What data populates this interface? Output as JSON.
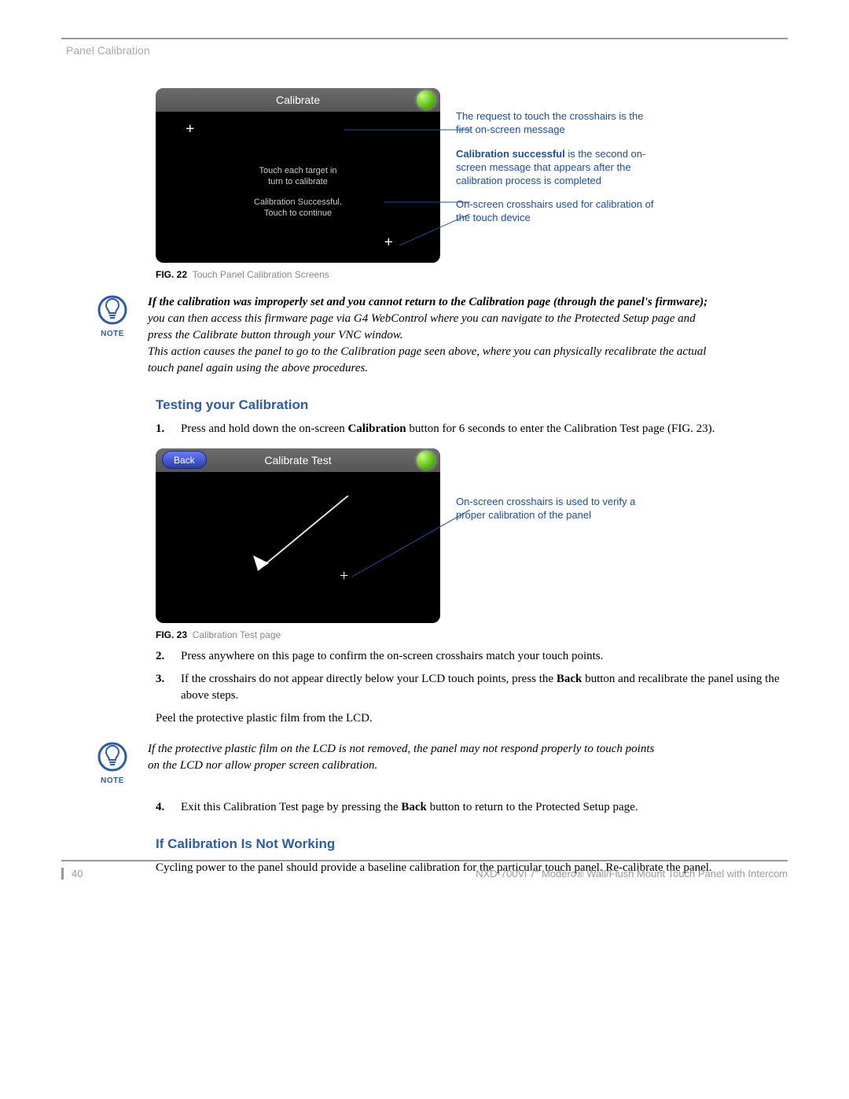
{
  "header": {
    "section_title": "Panel Calibration"
  },
  "fig22": {
    "screen_title": "Calibrate",
    "instruction1": "Touch each target in\nturn to calibrate",
    "instruction2": "Calibration Successful.\nTouch to continue",
    "caption_label": "FIG. 22",
    "caption_text": "Touch Panel Calibration Screens",
    "annot1": "The request to touch the crosshairs is the first on-screen message",
    "annot2_bold": "Calibration successful",
    "annot2_rest": " is the second on-screen message that appears after the calibration process is completed",
    "annot3": "On-screen crosshairs used for calibration of the touch device"
  },
  "note1": {
    "label": "NOTE",
    "bold_part": "If the calibration was improperly set and you cannot return to the Calibration page (through the panel's firmware);",
    "italic_part": " you can then access this firmware page via G4 WebControl where you can navigate to the Protected Setup page and press the Calibrate button through your VNC window.",
    "line2": "This action causes the panel to go to the Calibration page seen above, where you can physically recalibrate the actual touch panel again using the above procedures."
  },
  "heading1": "Testing your Calibration",
  "steps": {
    "s1_a": "Press and hold down the on-screen ",
    "s1_bold": "Calibration",
    "s1_b": " button for 6 seconds to enter the Calibration Test page (FIG. 23).",
    "s2": "Press anywhere on this page to confirm the on-screen crosshairs match your touch points.",
    "s3_a": "If the crosshairs do not appear directly below your LCD touch points, press the ",
    "s3_bold": "Back",
    "s3_b": " button and recalibrate the panel using the above steps.",
    "s4_a": "Exit this Calibration Test page by pressing the ",
    "s4_bold": "Back",
    "s4_b": " button to return to the Protected Setup page."
  },
  "fig23": {
    "screen_title": "Calibrate Test",
    "back_label": "Back",
    "caption_label": "FIG. 23",
    "caption_text": "Calibration Test page",
    "annot": "On-screen crosshairs is used to verify a proper calibration of the panel"
  },
  "peel_text": "Peel the protective plastic film from the LCD.",
  "note2": {
    "label": "NOTE",
    "text": "If the protective plastic film on the LCD is not removed, the panel may not respond properly to touch points on the LCD nor allow proper screen calibration."
  },
  "heading2": "If Calibration Is Not Working",
  "body2": "Cycling power to the panel should provide a baseline calibration for the particular touch panel. Re-calibrate the panel.",
  "footer": {
    "page": "40",
    "product": "NXD-700Vi 7\" Modero® Wall/Flush Mount Touch Panel with Intercom"
  }
}
